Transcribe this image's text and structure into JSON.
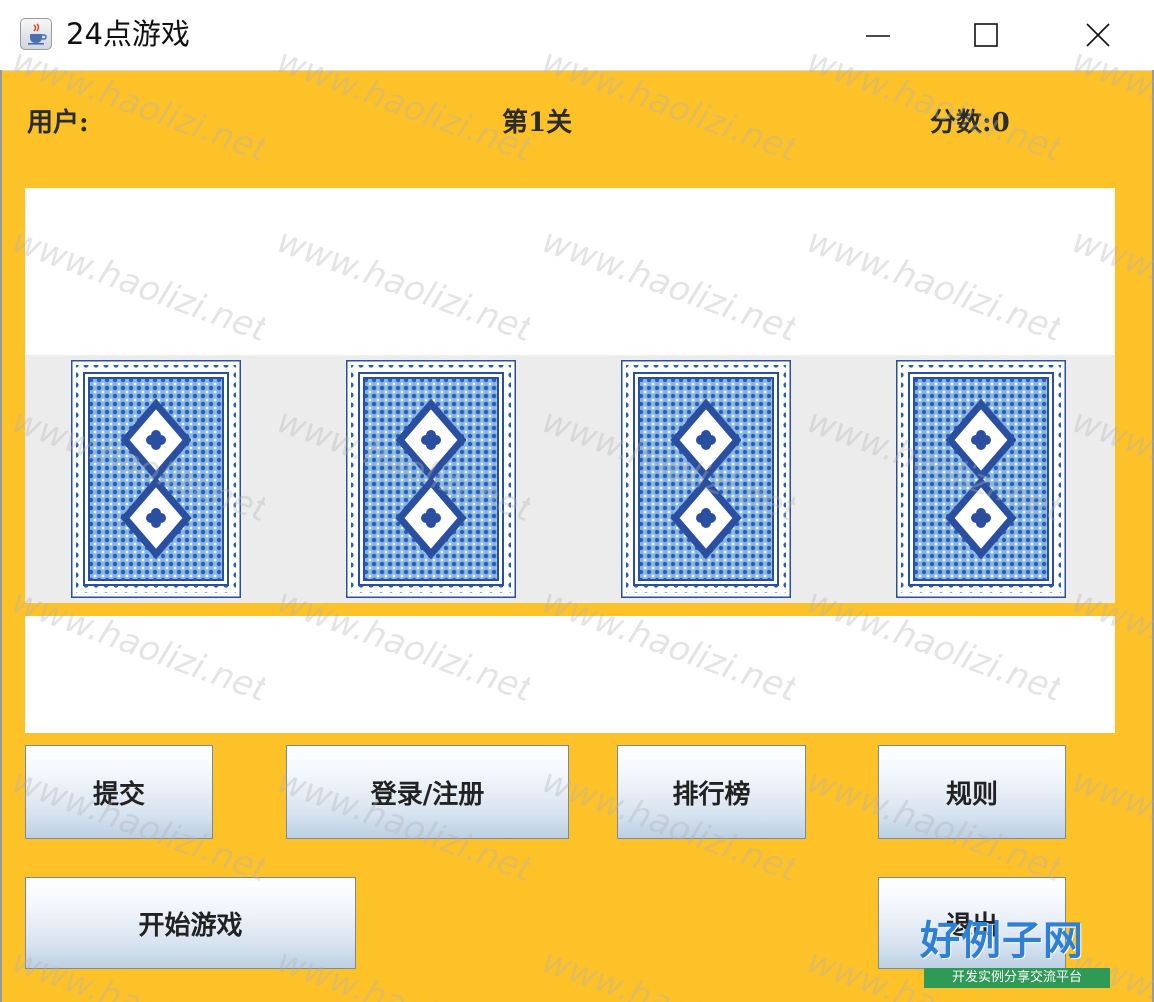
{
  "window": {
    "title": "24点游戏",
    "app_icon": "java-cup-icon",
    "controls": [
      "minimize-icon",
      "maximize-icon",
      "close-icon"
    ]
  },
  "header": {
    "user_label": "用户:",
    "level_label": "第1关",
    "score_label": "分数:0"
  },
  "cards": [
    {
      "face": "back"
    },
    {
      "face": "back"
    },
    {
      "face": "back"
    },
    {
      "face": "back"
    }
  ],
  "buttons": {
    "submit": "提交",
    "login_register": "登录/注册",
    "leaderboard": "排行榜",
    "rules": "规则",
    "start_game": "开始游戏",
    "exit": "退出"
  },
  "watermark": {
    "text": "www.haolizi.net",
    "logo_main": "好例子网",
    "logo_sub": "开发实例分享交流平台"
  },
  "colors": {
    "background": "#fec229",
    "card_blue": "#2e5fb3",
    "card_light": "#7fb2e6",
    "button_gradient_bottom": "#bccfe3",
    "logo_blue": "#2e7fd6",
    "logo_green": "#2f9a56"
  }
}
